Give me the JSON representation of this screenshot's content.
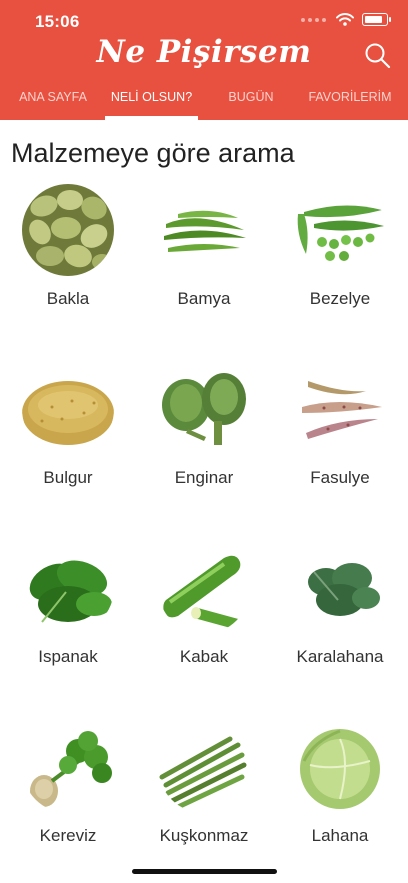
{
  "status_bar": {
    "time": "15:06"
  },
  "header": {
    "title": "Ne Pişirsem"
  },
  "tabs": [
    {
      "label": "ANA SAYFA",
      "active": false
    },
    {
      "label": "NELİ OLSUN?",
      "active": true
    },
    {
      "label": "BUGÜN",
      "active": false
    },
    {
      "label": "FAVORİLERİM",
      "active": false
    }
  ],
  "section": {
    "title": "Malzemeye göre arama"
  },
  "items": [
    {
      "label": "Bakla",
      "icon": "fava-bean-icon"
    },
    {
      "label": "Bamya",
      "icon": "okra-icon"
    },
    {
      "label": "Bezelye",
      "icon": "pea-icon"
    },
    {
      "label": "Bulgur",
      "icon": "bulgur-icon"
    },
    {
      "label": "Enginar",
      "icon": "artichoke-icon"
    },
    {
      "label": "Fasulye",
      "icon": "green-bean-icon"
    },
    {
      "label": "Ispanak",
      "icon": "spinach-icon"
    },
    {
      "label": "Kabak",
      "icon": "zucchini-icon"
    },
    {
      "label": "Karalahana",
      "icon": "collard-greens-icon"
    },
    {
      "label": "Kereviz",
      "icon": "celery-root-icon"
    },
    {
      "label": "Kuşkonmaz",
      "icon": "asparagus-icon"
    },
    {
      "label": "Lahana",
      "icon": "cabbage-icon"
    }
  ],
  "colors": {
    "header_bg": "#e8503f",
    "text": "#333333",
    "title_text": "#222222"
  }
}
